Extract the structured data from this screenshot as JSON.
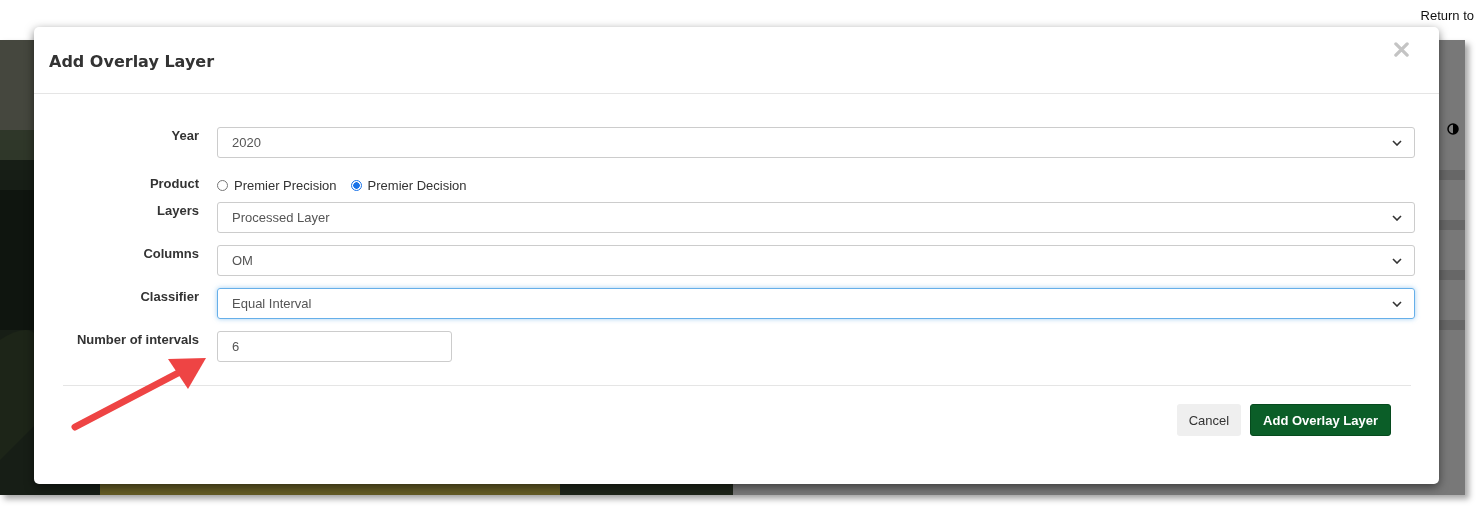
{
  "page": {
    "return_link": "Return to"
  },
  "dialog": {
    "title": "Add Overlay Layer",
    "fields": [
      {
        "kind": "select",
        "label": "Year",
        "value": "2020",
        "focused": false
      },
      {
        "kind": "radio",
        "label": "Product",
        "options": [
          {
            "label": "Premier Precision",
            "selected": false
          },
          {
            "label": "Premier Decision",
            "selected": true
          }
        ]
      },
      {
        "kind": "select",
        "label": "Layers",
        "value": "Processed Layer",
        "focused": false
      },
      {
        "kind": "select",
        "label": "Columns",
        "value": "OM",
        "focused": false
      },
      {
        "kind": "select",
        "label": "Classifier",
        "value": "Equal Interval",
        "focused": true
      },
      {
        "kind": "text",
        "label": "Number of intervals",
        "value": "6"
      }
    ],
    "buttons": [
      {
        "label": "Cancel",
        "kind": "secondary"
      },
      {
        "label": "Add Overlay Layer",
        "kind": "primary"
      }
    ]
  }
}
